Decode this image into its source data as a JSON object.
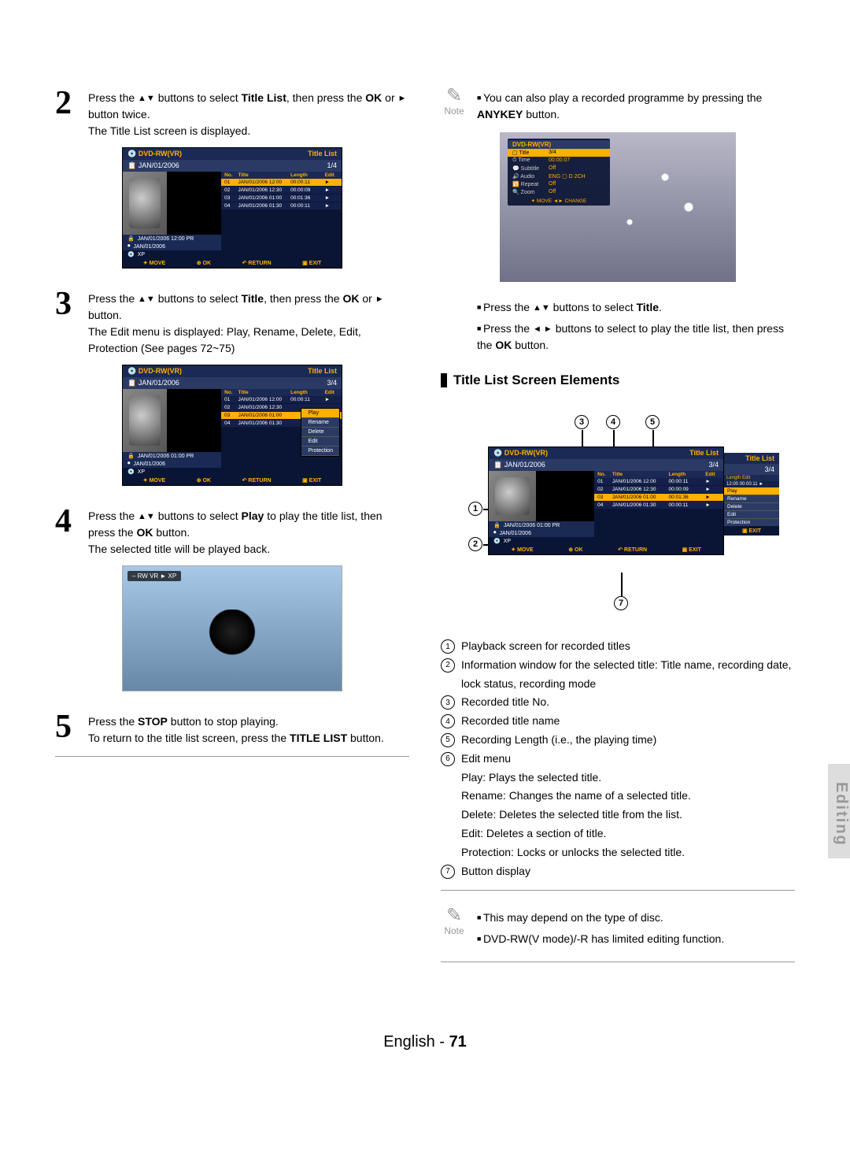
{
  "steps": {
    "s2": {
      "num": "2",
      "text_a": "Press the ",
      "text_b": " buttons to select ",
      "bold1": "Title List",
      "text_c": ", then press the ",
      "bold2": "OK",
      "text_d": " or ",
      "arrow": "►",
      "text_e": " button twice.",
      "line2": "The Title List screen is displayed."
    },
    "s3": {
      "num": "3",
      "text_a": "Press the ",
      "text_b": " buttons to select ",
      "bold1": "Title",
      "text_c": ", then press the ",
      "bold2": "OK",
      "text_d": " or ",
      "arrow": "►",
      "text_e": " button.",
      "line2": "The Edit menu is displayed: Play, Rename, Delete, Edit, Protection (See pages 72~75)"
    },
    "s4": {
      "num": "4",
      "text_a": "Press the ",
      "text_b": " buttons to select ",
      "bold1": "Play",
      "text_c": " to play the title list, then press the ",
      "bold2": "OK",
      "text_d": " button.",
      "line2": "The selected title will be played back."
    },
    "s5": {
      "num": "5",
      "text_a": "Press the ",
      "bold1": "STOP",
      "text_b": " button to stop playing.",
      "line2a": "To return to the title list screen, press the ",
      "bold2": "TITLE LIST",
      "line2b": " button."
    }
  },
  "osd": {
    "disc": "DVD-RW(VR)",
    "title": "Title List",
    "date": "JAN/01/2006",
    "page1": "1/4",
    "page3": "3/4",
    "hdr_no": "No.",
    "hdr_title": "Title",
    "hdr_len": "Length",
    "hdr_edit": "Edit",
    "rows": [
      {
        "no": "01",
        "ti": "JAN/01/2006 12:00",
        "le": "00:00:11",
        "ed": "►"
      },
      {
        "no": "02",
        "ti": "JAN/01/2006 12:30",
        "le": "00:00:09",
        "ed": "►"
      },
      {
        "no": "03",
        "ti": "JAN/01/2006 01:00",
        "le": "00:01:36",
        "ed": "►"
      },
      {
        "no": "04",
        "ti": "JAN/01/2006 01:30",
        "le": "00:00:11",
        "ed": "►"
      }
    ],
    "info1": "JAN/01/2006 12:00 PR",
    "info1b": "JAN/01/2006 01:00 PR",
    "info2": "JAN/01/2006",
    "info3": "XP",
    "bar_move": "MOVE",
    "bar_ok": "OK",
    "bar_return": "RETURN",
    "bar_exit": "EXIT",
    "menu": {
      "play": "Play",
      "rename": "Rename",
      "delete": "Delete",
      "edit": "Edit",
      "protection": "Protection"
    }
  },
  "playbar": "– RW    VR    ►    XP",
  "note1": {
    "label": "Note",
    "text_a": "You can also play a recorded programme by pressing the ",
    "bold": "ANYKEY",
    "text_b": " button."
  },
  "overlay": {
    "head": "DVD-RW(VR)",
    "r_title_k": "Title",
    "r_title_v": "3/4",
    "r_time_k": "Time",
    "r_time_v": "00:00:07",
    "r_sub_k": "Subtitle",
    "r_sub_v": "Off",
    "r_aud_k": "Audio",
    "r_aud_v": "ENG ▢ D 2CH",
    "r_rep_k": "Repeat",
    "r_rep_v": "Off",
    "r_zoom_k": "Zoom",
    "r_zoom_v": "Off",
    "foot": "✦ MOVE    ◄► CHANGE"
  },
  "bullets": {
    "b1a": "Press the ",
    "b1b": " buttons to select ",
    "b1bold": "Title",
    "b1c": ".",
    "b2a": "Press the ",
    "b2b": " buttons to select to play the title list, then press the ",
    "b2bold": "OK",
    "b2c": " button."
  },
  "section": {
    "heading": "Title List Screen Elements",
    "items": {
      "i1": "Playback screen for recorded titles",
      "i2": "Information window for the selected title: Title name, recording date, lock status, recording mode",
      "i3": "Recorded title No.",
      "i4": "Recorded title name",
      "i5": "Recording Length (i.e., the playing time)",
      "i6": "Edit menu",
      "i6a": "Play: Plays the selected title.",
      "i6b": "Rename: Changes the name of a selected title.",
      "i6c": "Delete: Deletes the selected title from the list.",
      "i6d": "Edit: Deletes a section of title.",
      "i6e": "Protection: Locks or unlocks the selected title.",
      "i7": "Button display"
    }
  },
  "note2": {
    "label": "Note",
    "l1": "This may depend on the type of disc.",
    "l2": "DVD-RW(V mode)/-R has limited editing function."
  },
  "sidetab": "Editing",
  "footer": {
    "lang": "English -",
    "page": "71"
  }
}
